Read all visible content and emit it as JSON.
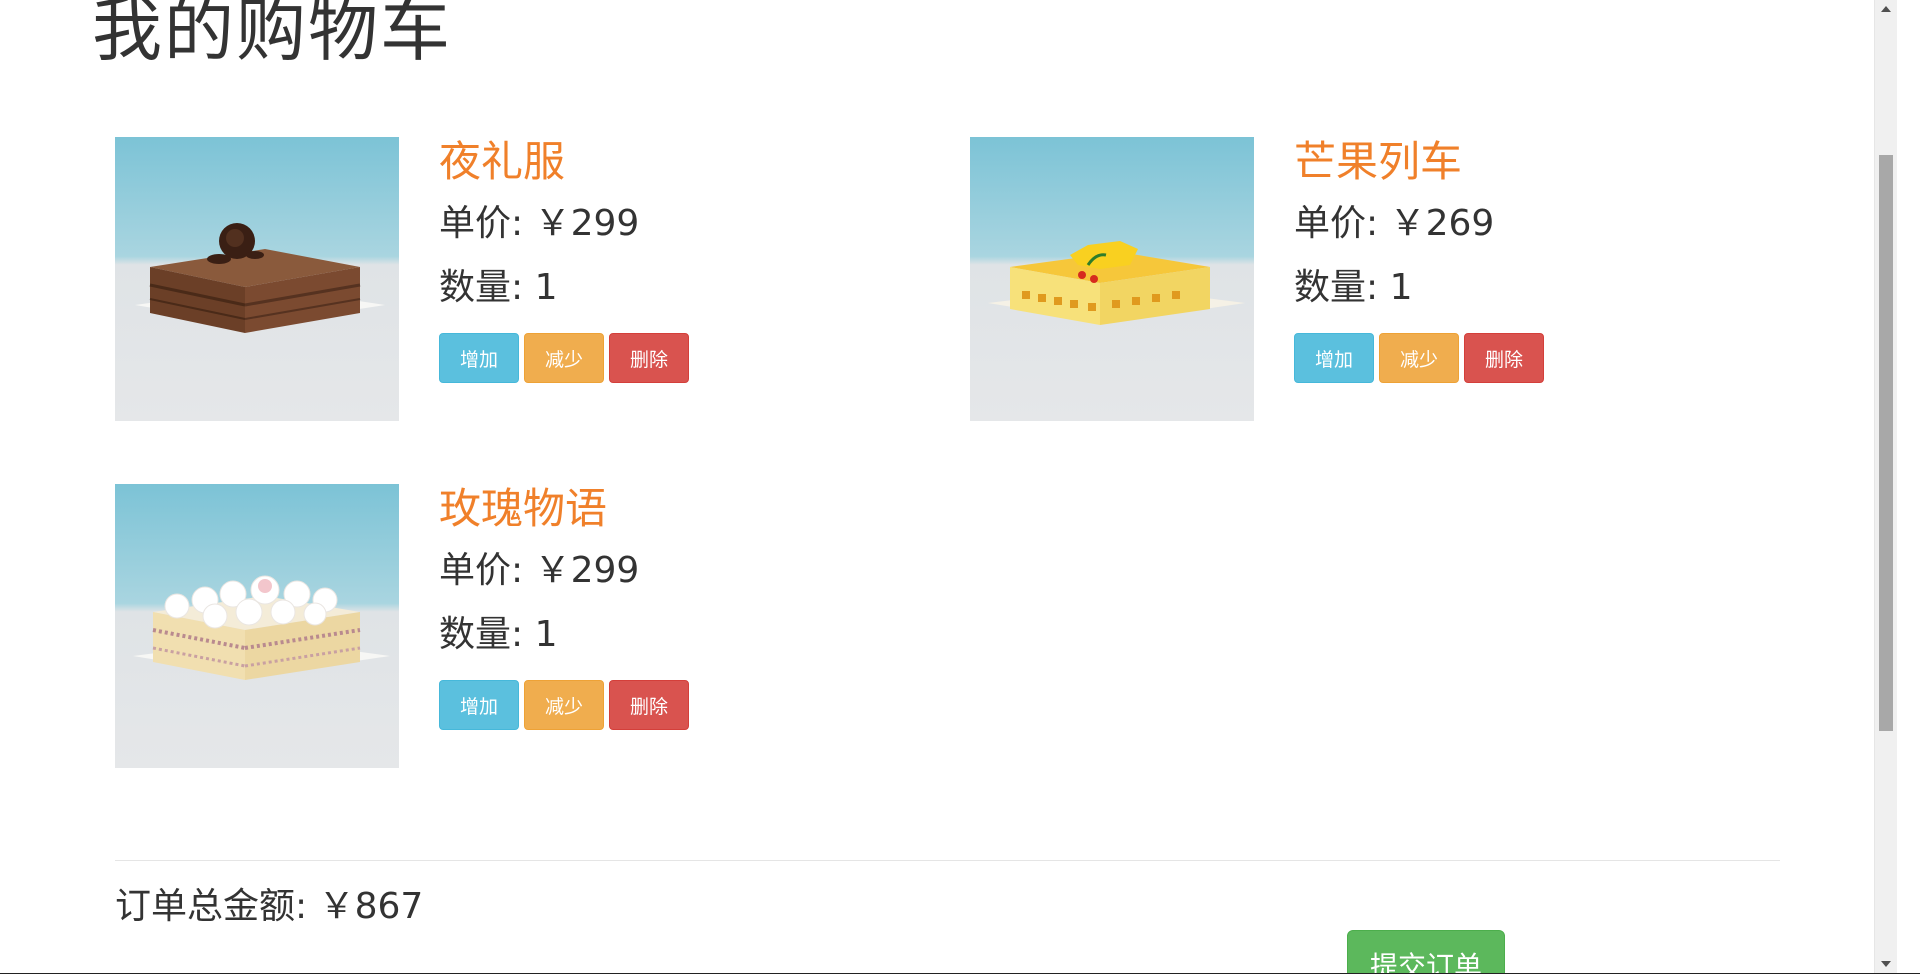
{
  "page": {
    "title": "我的购物车"
  },
  "cart": {
    "items": [
      {
        "name": "夜礼服",
        "price_text": "单价: ￥299",
        "quantity_text": "数量: 1",
        "add_label": "增加",
        "sub_label": "减少",
        "del_label": "删除",
        "image_icon": "chocolate-cake-image"
      },
      {
        "name": "芒果列车",
        "price_text": "单价: ￥269",
        "quantity_text": "数量: 1",
        "add_label": "增加",
        "sub_label": "减少",
        "del_label": "删除",
        "image_icon": "mango-cake-image"
      },
      {
        "name": "玫瑰物语",
        "price_text": "单价: ￥299",
        "quantity_text": "数量: 1",
        "add_label": "增加",
        "sub_label": "减少",
        "del_label": "删除",
        "image_icon": "rose-cream-cake-image"
      }
    ]
  },
  "summary": {
    "total_text": "订单总金额: ￥867",
    "submit_label": "提交订单"
  },
  "colors": {
    "item_name": "#f0802a",
    "add_button": "#5bc0de",
    "sub_button": "#f0ad4e",
    "delete_button": "#d9534f",
    "submit_button": "#5cb85c"
  }
}
